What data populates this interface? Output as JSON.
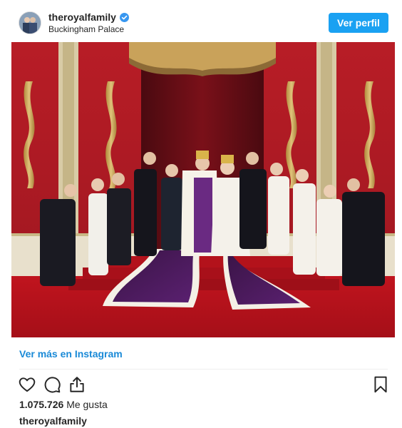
{
  "header": {
    "account_name": "theroyalfamily",
    "location": "Buckingham Palace",
    "view_profile_label": "Ver perfil"
  },
  "icons": {
    "verified": "verified-badge-icon",
    "like": "heart-icon",
    "comment": "comment-icon",
    "share": "share-icon",
    "save": "bookmark-icon"
  },
  "colors": {
    "accent_blue": "#1aa1f2",
    "link_blue": "#1a8ad7",
    "text": "#262626"
  },
  "footer": {
    "view_more_label": "Ver más en Instagram",
    "likes_count": "1.075.726",
    "likes_label": "Me gusta",
    "caption_username": "theroyalfamily"
  }
}
